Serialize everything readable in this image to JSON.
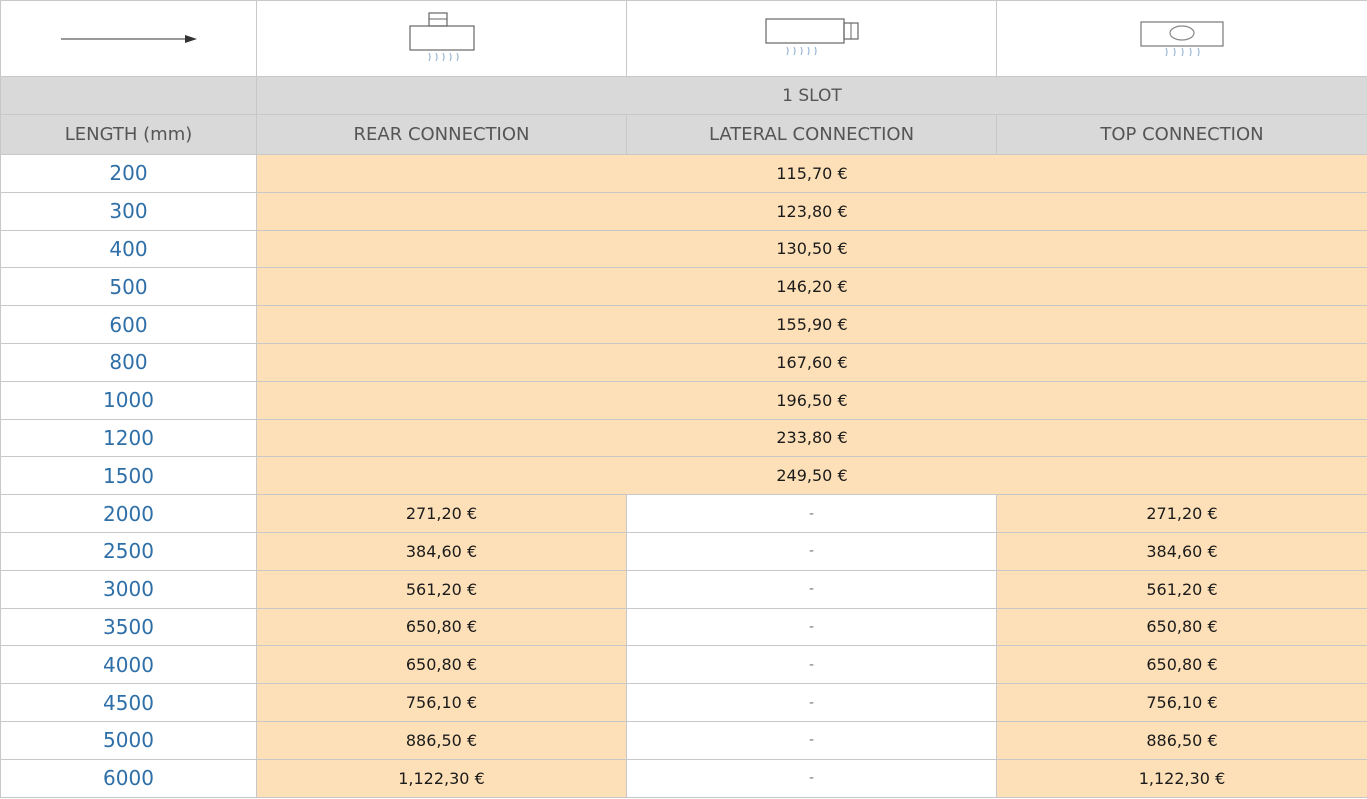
{
  "header": {
    "arrow_icon": "arrow-right-icon",
    "connection_icons": [
      "rear-connection-icon",
      "lateral-connection-icon",
      "top-connection-icon"
    ],
    "slot_label": "1 SLOT",
    "columns": [
      "LENGTH (mm)",
      "REAR CONNECTION",
      "LATERAL CONNECTION",
      "TOP CONNECTION"
    ]
  },
  "colors": {
    "price_fill": "#fde0b8",
    "length_text": "#2f6fa8",
    "header_fill": "#d9d9d9"
  },
  "rows_single": [
    {
      "length": "200",
      "price": "115,70 €"
    },
    {
      "length": "300",
      "price": "123,80 €"
    },
    {
      "length": "400",
      "price": "130,50 €"
    },
    {
      "length": "500",
      "price": "146,20 €"
    },
    {
      "length": "600",
      "price": "155,90 €"
    },
    {
      "length": "800",
      "price": "167,60 €"
    },
    {
      "length": "1000",
      "price": "196,50 €"
    },
    {
      "length": "1200",
      "price": "233,80 €"
    },
    {
      "length": "1500",
      "price": "249,50 €"
    }
  ],
  "rows_split": [
    {
      "length": "2000",
      "rear": "271,20 €",
      "lateral": "-",
      "top": "271,20 €"
    },
    {
      "length": "2500",
      "rear": "384,60 €",
      "lateral": "-",
      "top": "384,60 €"
    },
    {
      "length": "3000",
      "rear": "561,20 €",
      "lateral": "-",
      "top": "561,20 €"
    },
    {
      "length": "3500",
      "rear": "650,80 €",
      "lateral": "-",
      "top": "650,80 €"
    },
    {
      "length": "4000",
      "rear": "650,80 €",
      "lateral": "-",
      "top": "650,80 €"
    },
    {
      "length": "4500",
      "rear": "756,10 €",
      "lateral": "-",
      "top": "756,10 €"
    },
    {
      "length": "5000",
      "rear": "886,50 €",
      "lateral": "-",
      "top": "886,50 €"
    },
    {
      "length": "6000",
      "rear": "1,122,30 €",
      "lateral": "-",
      "top": "1,122,30 €"
    }
  ]
}
